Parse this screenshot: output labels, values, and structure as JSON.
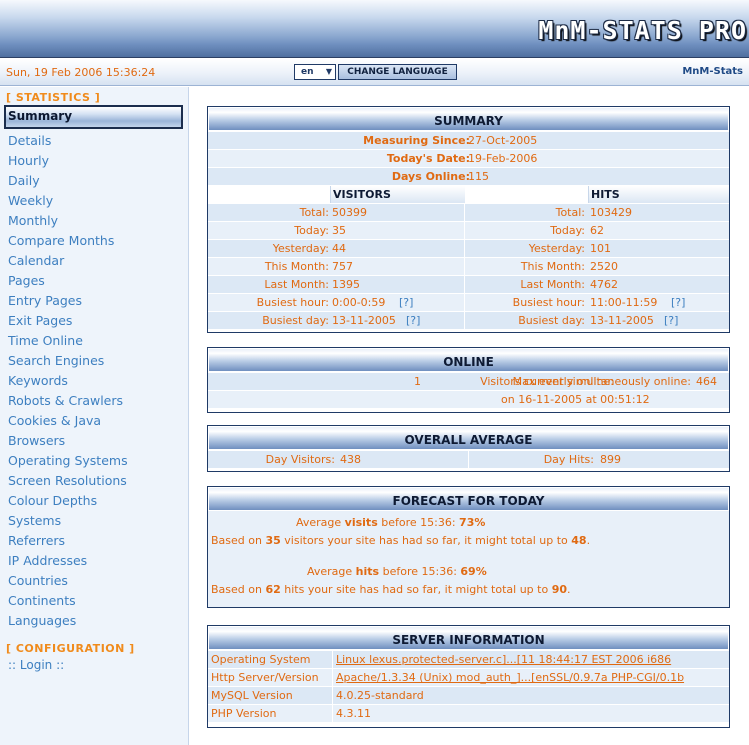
{
  "header": {
    "logo_text": "MnM-STATS PRO",
    "date": "Sun, 19 Feb 2006 15:36:24",
    "language_value": "en",
    "language_button": "CHANGE LANGUAGE",
    "brand_link": "MnM-Stats"
  },
  "sidebar": {
    "statistics_heading": "[ STATISTICS ]",
    "active_item": "Summary",
    "items": [
      "Details",
      "Hourly",
      "Daily",
      "Weekly",
      "Monthly",
      "Compare Months",
      "Calendar",
      "Pages",
      "Entry Pages",
      "Exit Pages",
      "Time Online",
      "Search Engines",
      "Keywords",
      "Robots & Crawlers",
      "Cookies & Java",
      "Browsers",
      "Operating Systems",
      "Screen Resolutions",
      "Colour Depths",
      "Systems",
      "Referrers",
      "IP Addresses",
      "Countries",
      "Continents",
      "Languages"
    ],
    "configuration_heading": "[ CONFIGURATION ]",
    "login": ":: Login ::"
  },
  "summary": {
    "title": "SUMMARY",
    "measuring_label": "Measuring Since:",
    "measuring_value": "27-Oct-2005",
    "today_date_label": "Today's Date:",
    "today_date_value": "19-Feb-2006",
    "days_online_label": "Days Online:",
    "days_online_value": "115",
    "visitors_head": "VISITORS",
    "hits_head": "HITS",
    "rows": [
      {
        "label": "Total:",
        "visitors": "50399",
        "hits": "103429"
      },
      {
        "label": "Today:",
        "visitors": "35",
        "hits": "62"
      },
      {
        "label": "Yesterday:",
        "visitors": "44",
        "hits": "101"
      },
      {
        "label": "This Month:",
        "visitors": "757",
        "hits": "2520"
      },
      {
        "label": "Last Month:",
        "visitors": "1395",
        "hits": "4762"
      },
      {
        "label": "Busiest hour:",
        "visitors": "0:00-0:59",
        "hits": "11:00-11:59"
      },
      {
        "label": "Busiest day:",
        "visitors": "13-11-2005",
        "hits": "13-11-2005"
      }
    ],
    "help_link": "[?]"
  },
  "online": {
    "title": "ONLINE",
    "current_label": "Visitors currently online:",
    "current_value": "1",
    "max_label": "Max ever simultaneously online:",
    "max_value": "464",
    "max_date": "on 16-11-2005 at 00:51:12"
  },
  "average": {
    "title": "OVERALL AVERAGE",
    "day_visitors_label": "Day Visitors:",
    "day_visitors_value": "438",
    "day_hits_label": "Day Hits:",
    "day_hits_value": "899"
  },
  "forecast": {
    "title": "FORECAST FOR TODAY",
    "visits_pre": "Average ",
    "visits_word": "visits",
    "visits_mid": " before 15:36: ",
    "visits_pct": "73%",
    "visits_based_pre": "Based on ",
    "visits_count": "35",
    "visits_based_mid": " visitors your site has had so far, it might total up to ",
    "visits_total": "48",
    "visits_end": ".",
    "hits_pre": "Average ",
    "hits_word": "hits",
    "hits_mid": " before 15:36: ",
    "hits_pct": "69%",
    "hits_based_pre": "Based on ",
    "hits_count": "62",
    "hits_based_mid": " hits your site has had so far, it might total up to ",
    "hits_total": "90",
    "hits_end": "."
  },
  "server": {
    "title": "SERVER INFORMATION",
    "rows": [
      {
        "label": "Operating System",
        "value": "Linux lexus.protected-server.c]...[11 18:44:17 EST 2006 i686"
      },
      {
        "label": "Http Server/Version",
        "value": "Apache/1.3.34 (Unix) mod_auth_]...[enSSL/0.9.7a PHP-CGI/0.1b"
      },
      {
        "label": "MySQL Version",
        "value": "4.0.25-standard"
      },
      {
        "label": "PHP Version",
        "value": "4.3.11"
      }
    ]
  }
}
